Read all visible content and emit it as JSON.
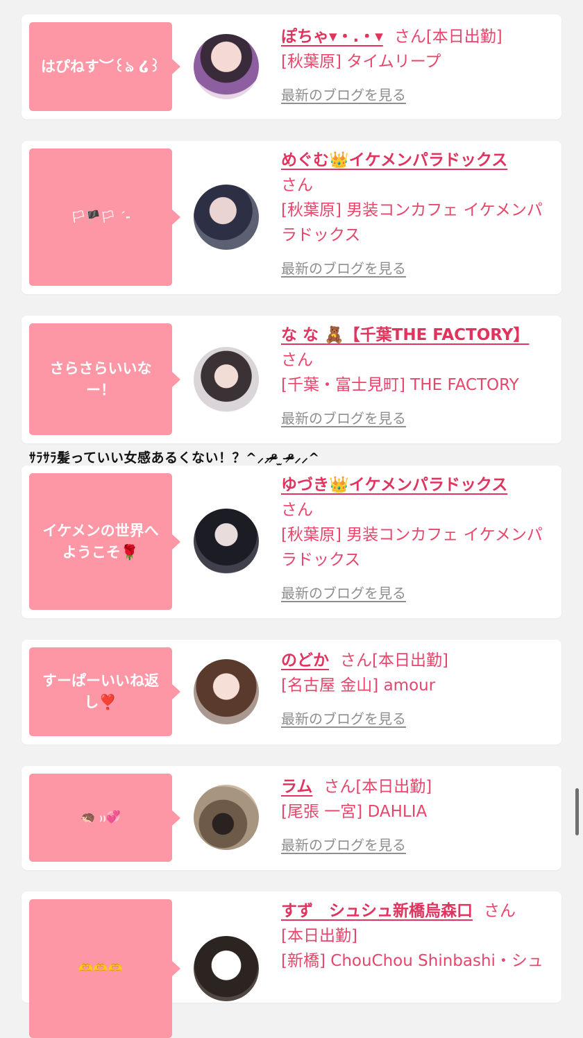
{
  "cards": [
    {
      "comment": "はぴねす︶꒰ঌ ໒꒱",
      "name": "ぽちゃ▾・.・▾",
      "san": "さん",
      "status": "[本日出勤]",
      "shop": "[秋葉原] タイムリープ",
      "blog": "最新のブログを見る"
    },
    {
      "comment": "🏳🏴🏳 ˊ-",
      "name": "めぐむ👑イケメンパラドックス",
      "san": "さん",
      "status": "",
      "shop": "[秋葉原] 男装コンカフェ イケメンパラドックス",
      "blog": "最新のブログを見る"
    },
    {
      "comment": "さらさらいいなー！",
      "name": "な な 🧸【千葉THE FACTORY】",
      "san": "さん",
      "status": "",
      "shop": "[千葉・富士見町] THE FACTORY",
      "blog": "最新のブログを見る"
    },
    {
      "comment": "イケメンの世界へようこそ🌹",
      "name": "ゆづき👑イケメンパラドックス",
      "san": "さん",
      "status": "",
      "shop": "[秋葉原] 男装コンカフェ イケメンパラドックス",
      "blog": "最新のブログを見る"
    },
    {
      "comment": "すーぱーいいね返し❣️",
      "name": "のどか",
      "san": "さん",
      "status": "[本日出勤]",
      "shop": "[名古屋 金山] amour",
      "blog": "最新のブログを見る"
    },
    {
      "comment": "🦔 ₎₎💞",
      "name": "ラム",
      "san": "さん",
      "status": "[本日出勤]",
      "shop": "[尾張 一宮] DAHLIA",
      "blog": "最新のブログを見る"
    },
    {
      "comment": "🫶🫶🫶",
      "name": "すず　シュシュ新橋烏森口",
      "san": "さん",
      "status": "[本日出勤]",
      "shop": "[新橋] ChouChou Shinbashi・シュ",
      "blog": ""
    }
  ],
  "caption": "ｻﾗｻﾗ髪っていい女感あるくない！？^⸝⸝ᵒ̴̶̷ ̫ ᵒ̴̶̷⸝⸝^",
  "colors": {
    "bubble": "#fd97a5",
    "name": "#e0335d",
    "text": "#e8456b",
    "link": "#8e8e8e"
  }
}
